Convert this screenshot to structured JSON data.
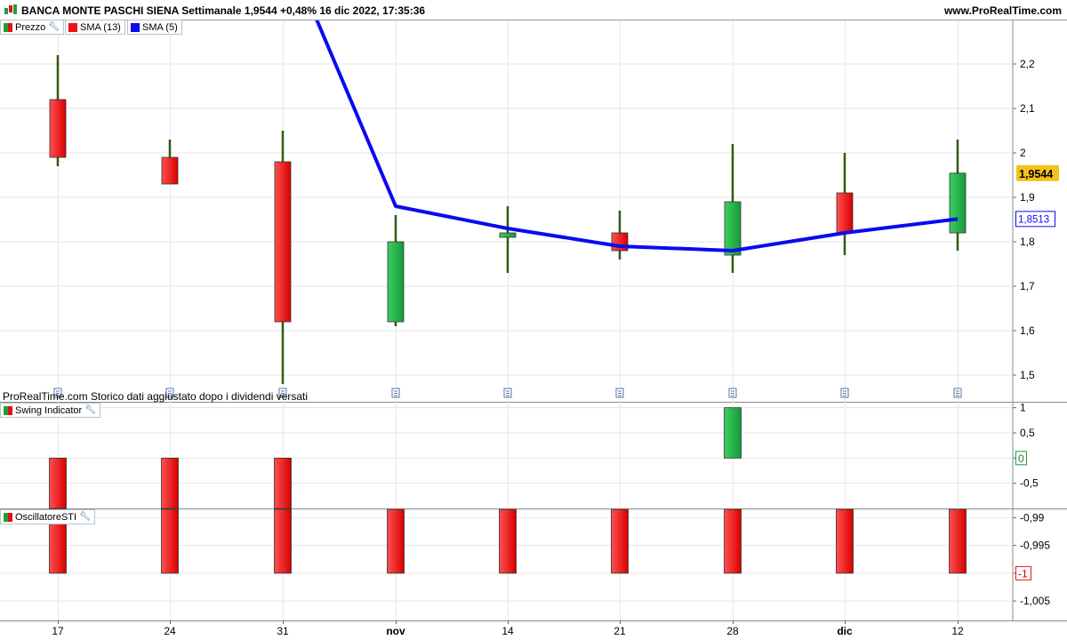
{
  "header": {
    "title": "BANCA MONTE PASCHI SIENA Settimanale 1,9544 +0,48% 16 dic 2022, 17:35:36",
    "brand": "www.ProRealTime.com"
  },
  "legend": {
    "price": "Prezzo",
    "sma13": "SMA (13)",
    "sma5": "SMA (5)",
    "swing": "Swing Indicator",
    "osc": "OscillatoreSTI"
  },
  "notice": "ProRealTime.com Storico dati aggiustato dopo i dividendi versati",
  "icons": [
    "logo-icon",
    "wrench-icon",
    "dividend-icon"
  ],
  "colors": {
    "up": "#1f9e3a",
    "down": "#ee1111",
    "sma5": "#0a0af0",
    "wick": "#2f5a12",
    "last_price_bg": "#f3c21b"
  },
  "chart_data": [
    {
      "type": "candlestick",
      "categories": [
        "17",
        "24",
        "31",
        "nov",
        "14",
        "21",
        "28",
        "dic",
        "12"
      ],
      "ohlc": [
        [
          2.12,
          2.22,
          1.97,
          1.99
        ],
        [
          1.99,
          2.03,
          1.93,
          1.93
        ],
        [
          1.98,
          2.05,
          1.48,
          1.62
        ],
        [
          1.62,
          1.86,
          1.61,
          1.8
        ],
        [
          1.81,
          1.88,
          1.73,
          1.82
        ],
        [
          1.82,
          1.87,
          1.76,
          1.78
        ],
        [
          1.77,
          2.02,
          1.73,
          1.89
        ],
        [
          1.91,
          2.0,
          1.77,
          1.82
        ],
        [
          1.82,
          2.03,
          1.78,
          1.9544
        ]
      ],
      "series": [
        {
          "name": "SMA (5)",
          "values": [
            null,
            null,
            null,
            1.88,
            1.83,
            1.79,
            1.78,
            1.82,
            1.8513
          ]
        }
      ],
      "ylim": [
        1.48,
        2.3
      ],
      "yticks": [
        {
          "v": 2.2,
          "l": "2,2"
        },
        {
          "v": 2.1,
          "l": "2,1"
        },
        {
          "v": 2.0,
          "l": "2"
        },
        {
          "v": 1.9,
          "l": "1,9"
        },
        {
          "v": 1.8,
          "l": "1,8"
        },
        {
          "v": 1.7,
          "l": "1,7"
        },
        {
          "v": 1.6,
          "l": "1,6"
        },
        {
          "v": 1.5,
          "l": "1,5"
        }
      ],
      "last_price": {
        "v": 1.9544,
        "l": "1,9544"
      },
      "last_sma": {
        "v": 1.8513,
        "l": "1,8513"
      },
      "dividend_markers": [
        true,
        true,
        true,
        true,
        true,
        true,
        true,
        true,
        true
      ]
    },
    {
      "type": "bar",
      "categories": [
        "17",
        "24",
        "31",
        "nov",
        "14",
        "21",
        "28",
        "dic",
        "12"
      ],
      "values": [
        -1,
        -1,
        -1,
        0,
        0,
        0,
        1,
        0,
        0
      ],
      "ylim": [
        -1,
        1.1
      ],
      "yticks": [
        {
          "v": 1,
          "l": "1"
        },
        {
          "v": 0.5,
          "l": "0,5"
        },
        {
          "v": 0,
          "l": "0"
        },
        {
          "v": -0.5,
          "l": "-0,5"
        }
      ],
      "current": {
        "v": 0,
        "l": "0"
      }
    },
    {
      "type": "bar",
      "categories": [
        "17",
        "24",
        "31",
        "nov",
        "14",
        "21",
        "28",
        "dic",
        "12"
      ],
      "values": [
        -1,
        -1,
        -1,
        -1,
        -1,
        -1,
        -1,
        -1,
        -1
      ],
      "ylim": [
        -1.0085,
        -0.9885
      ],
      "yticks": [
        {
          "v": -0.99,
          "l": "-0,99"
        },
        {
          "v": -0.995,
          "l": "-0,995"
        },
        {
          "v": -1,
          "l": "-1"
        },
        {
          "v": -1.005,
          "l": "-1,005"
        }
      ],
      "current": {
        "v": -1,
        "l": "-1"
      }
    }
  ],
  "x_axis": {
    "labels": [
      "17",
      "24",
      "31",
      "nov",
      "14",
      "21",
      "28",
      "dic",
      "12"
    ],
    "bold": [
      false,
      false,
      false,
      true,
      false,
      false,
      false,
      true,
      false
    ]
  }
}
